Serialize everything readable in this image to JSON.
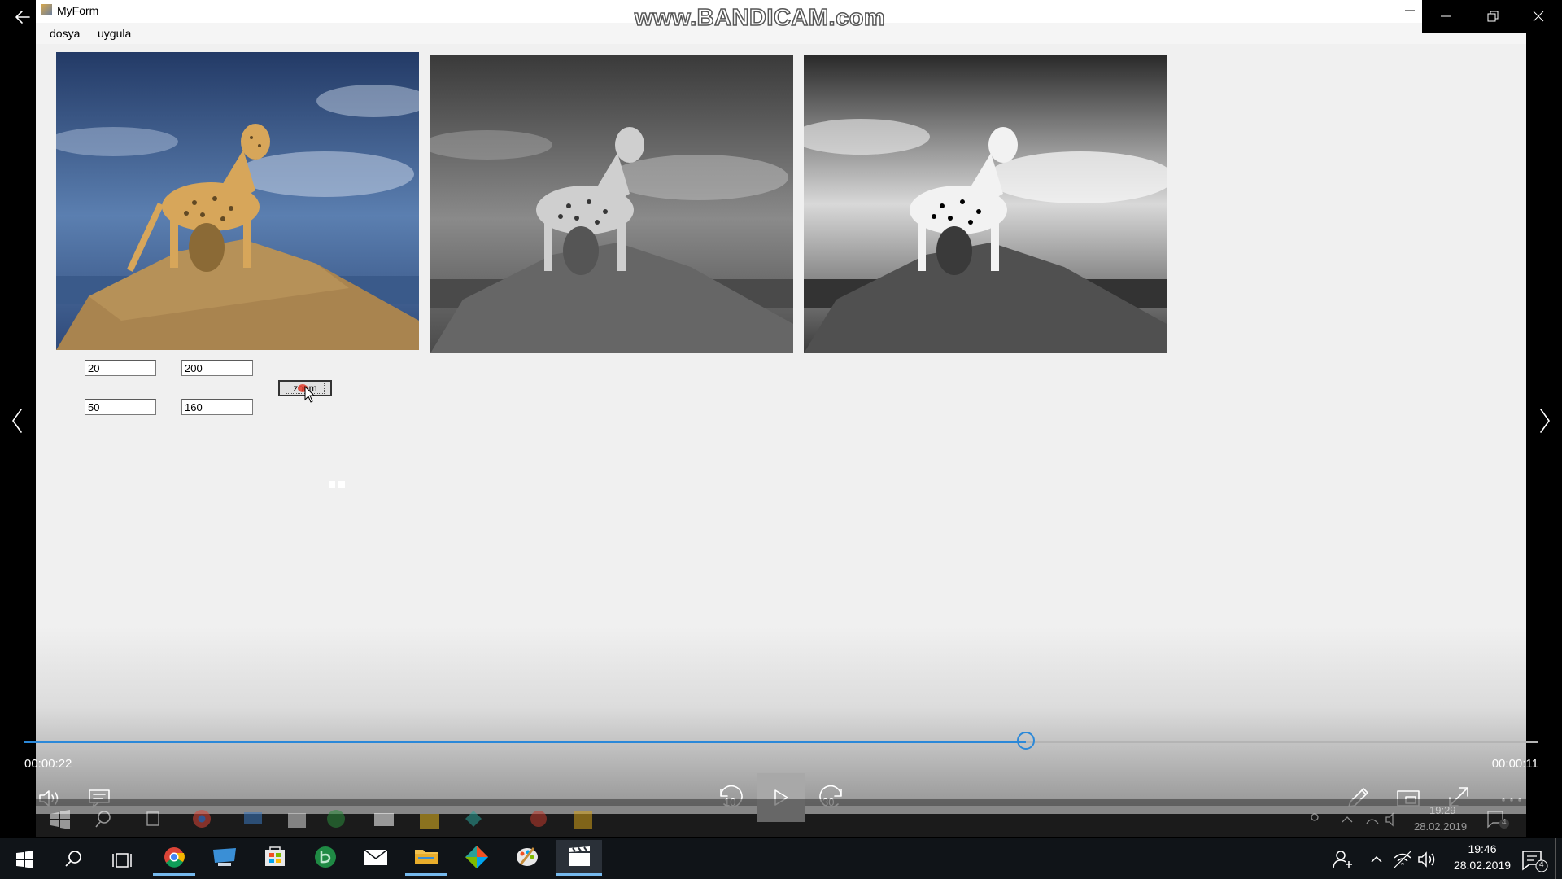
{
  "watermark": "www.BANDICAM.com",
  "window": {
    "title": "MyForm",
    "menu": [
      "dosya",
      "uygula"
    ]
  },
  "inputs": [
    {
      "name": "input-1",
      "value": "20"
    },
    {
      "name": "input-2",
      "value": "200"
    },
    {
      "name": "input-3",
      "value": "50"
    },
    {
      "name": "input-4",
      "value": "160"
    }
  ],
  "zoom_button": "zoom",
  "player": {
    "elapsed": "00:00:22",
    "remaining": "00:00:11",
    "progress": 0.662,
    "rewind_seconds": "10",
    "forward_seconds": "30"
  },
  "inner_taskbar": {
    "time": "19:29",
    "date": "28.02.2019",
    "notifications": "4"
  },
  "taskbar": {
    "time": "19:46",
    "date": "28.02.2019",
    "notifications": "4"
  },
  "colors": {
    "accent": "#0078d7",
    "player_accent": "#2b88d8"
  }
}
